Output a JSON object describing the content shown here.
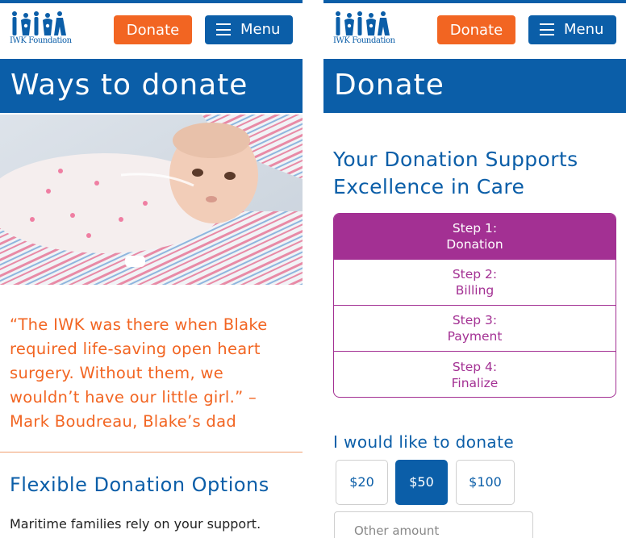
{
  "colors": {
    "brand_blue": "#0b5ea8",
    "accent_orange": "#f26522",
    "step_purple": "#a33093"
  },
  "left_page": {
    "header": {
      "logo_icon": "iwk-figures-logo",
      "logo_text": "IWK Foundation",
      "donate_label": "Donate",
      "menu_icon": "hamburger-icon",
      "menu_label": "Menu"
    },
    "banner_title": "Ways to donate",
    "quote": "“The IWK was there when Blake required life-saving open heart surgery. Without them, we wouldn’t have our little girl.” – Mark Boudreau, Blake’s dad",
    "section_heading": "Flexible Donation Options",
    "section_text": "Maritime families rely on your support."
  },
  "right_page": {
    "header": {
      "logo_icon": "iwk-figures-logo",
      "logo_text": "IWK Foundation",
      "donate_label": "Donate",
      "menu_icon": "hamburger-icon",
      "menu_label": "Menu"
    },
    "banner_title": "Donate",
    "heading": "Your Donation Supports Excellence in Care",
    "steps": [
      {
        "step": "Step 1:",
        "name": "Donation",
        "active": true
      },
      {
        "step": "Step 2:",
        "name": "Billing",
        "active": false
      },
      {
        "step": "Step 3:",
        "name": "Payment",
        "active": false
      },
      {
        "step": "Step 4:",
        "name": "Finalize",
        "active": false
      }
    ],
    "donate_label": "I would like to donate",
    "amounts": [
      "$20",
      "$50",
      "$100"
    ],
    "selected_amount": "$50",
    "other_amount_placeholder": "Other amount"
  }
}
